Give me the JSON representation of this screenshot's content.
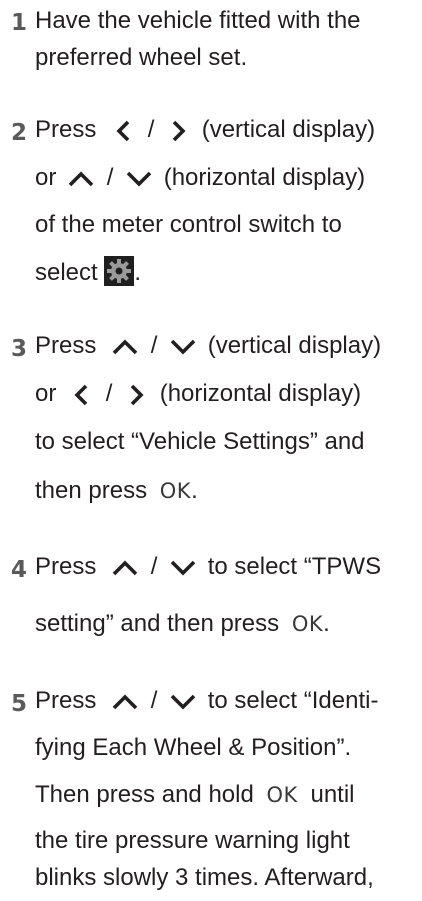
{
  "steps": [
    {
      "number": "1",
      "lines": [
        "Have the vehicle fitted with the",
        "preferred wheel set."
      ]
    },
    {
      "number": "2",
      "press": "Press",
      "slash": "/",
      "vertical_display": "(vertical display)",
      "or": "or",
      "horizontal_display": "(horizontal display)",
      "line3": "of the meter control switch to",
      "select": "select",
      "period": ".",
      "icons": [
        "chevron-left-icon",
        "chevron-right-icon",
        "chevron-up-icon",
        "chevron-down-icon",
        "gear-icon"
      ]
    },
    {
      "number": "3",
      "press": "Press",
      "slash": "/",
      "vertical_display": "(vertical display)",
      "or": "or",
      "horizontal_display": "(horizontal display)",
      "line3": "to select “Vehicle Settings” and",
      "line4_pre": "then press",
      "ok": "OK",
      "period": "."
    },
    {
      "number": "4",
      "press": "Press",
      "slash": "/",
      "line1_post": "to select “TPWS",
      "line2_pre": "setting” and then press",
      "ok": "OK",
      "period": "."
    },
    {
      "number": "5",
      "press": "Press",
      "slash": "/",
      "line1_post": "to select “Identi-",
      "line2": "fying Each Wheel & Position”.",
      "line3_pre": "Then press and hold",
      "ok": "OK",
      "line3_post": "until",
      "line4": "the tire pressure warning light",
      "line5": "blinks slowly 3 times. Afterward,"
    }
  ],
  "colors": {
    "text": "#231f20",
    "number": "#5a5a5a",
    "gear_bg": "#1f1f1f",
    "gear_fg": "#9a9a9a"
  }
}
